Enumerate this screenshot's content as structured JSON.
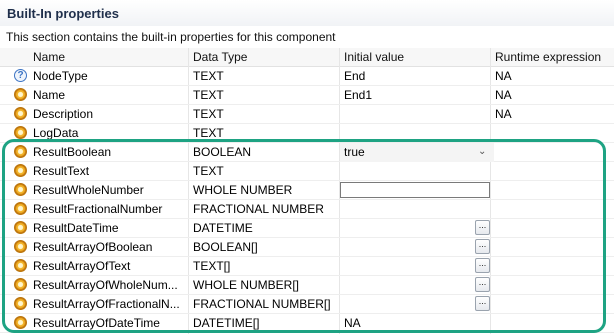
{
  "section": {
    "title": "Built-In properties",
    "description": "This section contains the built-in properties for this component"
  },
  "columns": [
    "Name",
    "Data Type",
    "Initial value",
    "Runtime expression"
  ],
  "rows": [
    {
      "name": "NodeType",
      "type": "TEXT",
      "initial": "End",
      "runtime": "NA",
      "icon": "help-icon"
    },
    {
      "name": "Name",
      "type": "TEXT",
      "initial": "End1",
      "runtime": "NA",
      "icon": "gear-icon"
    },
    {
      "name": "Description",
      "type": "TEXT",
      "initial": "",
      "runtime": "NA",
      "icon": "gear-icon"
    },
    {
      "name": "LogData",
      "type": "TEXT",
      "initial": "",
      "runtime": "",
      "icon": "gear-icon"
    },
    {
      "name": "ResultBoolean",
      "type": "BOOLEAN",
      "initial": "true",
      "runtime": "",
      "icon": "gear-icon"
    },
    {
      "name": "ResultText",
      "type": "TEXT",
      "initial": "",
      "runtime": "",
      "icon": "gear-icon"
    },
    {
      "name": "ResultWholeNumber",
      "type": "WHOLE NUMBER",
      "initial": "",
      "runtime": "",
      "icon": "gear-icon"
    },
    {
      "name": "ResultFractionalNumber",
      "type": "FRACTIONAL NUMBER",
      "initial": "",
      "runtime": "",
      "icon": "gear-icon"
    },
    {
      "name": "ResultDateTime",
      "type": "DATETIME",
      "initial": "",
      "runtime": "",
      "icon": "gear-icon"
    },
    {
      "name": "ResultArrayOfBoolean",
      "type": "BOOLEAN[]",
      "initial": "",
      "runtime": "",
      "icon": "gear-icon"
    },
    {
      "name": "ResultArrayOfText",
      "type": "TEXT[]",
      "initial": "",
      "runtime": "",
      "icon": "gear-icon"
    },
    {
      "name": "ResultArrayOfWholeNum...",
      "type": "WHOLE NUMBER[]",
      "initial": "",
      "runtime": "",
      "icon": "gear-icon"
    },
    {
      "name": "ResultArrayOfFractionalN...",
      "type": "FRACTIONAL NUMBER[]",
      "initial": "",
      "runtime": "",
      "icon": "gear-icon"
    },
    {
      "name": "ResultArrayOfDateTime",
      "type": "DATETIME[]",
      "initial": "NA",
      "runtime": "",
      "icon": "gear-icon"
    }
  ],
  "ellipsis_label": "...",
  "colors": {
    "highlight": "#1ea383",
    "title": "#1f2f4b"
  }
}
